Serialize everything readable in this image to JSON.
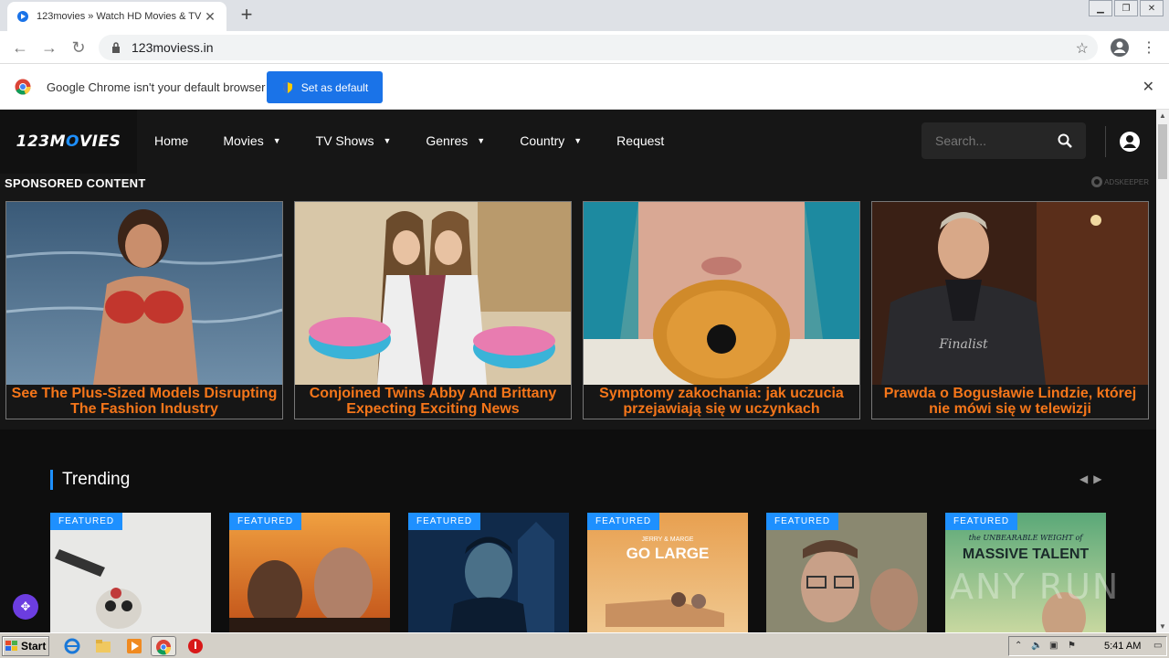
{
  "browser": {
    "tab_title": "123movies » Watch HD Movies & TV",
    "tab_close": "✕",
    "new_tab": "+",
    "url": "123moviess.in",
    "infobar_message": "Google Chrome isn't your default browser",
    "set_default_label": "Set as default",
    "infobar_close": "✕"
  },
  "site": {
    "logo_prefix": "123M",
    "logo_mid": "O",
    "logo_suffix": "VIES",
    "nav": [
      {
        "label": "Home",
        "dropdown": false
      },
      {
        "label": "Movies",
        "dropdown": true
      },
      {
        "label": "TV Shows",
        "dropdown": true
      },
      {
        "label": "Genres",
        "dropdown": true
      },
      {
        "label": "Country",
        "dropdown": true
      },
      {
        "label": "Request",
        "dropdown": false
      }
    ],
    "search_placeholder": "Search..."
  },
  "sponsored": {
    "heading": "SPONSORED CONTENT",
    "provider": "ADSKEEPER",
    "ads": [
      {
        "caption": "See The Plus-Sized Models Disrupting The Fashion Industry"
      },
      {
        "caption": "Conjoined Twins Abby And Brittany Expecting Exciting News"
      },
      {
        "caption": "Symptomy zakochania: jak uczucia przejawiają się w uczynkach"
      },
      {
        "caption": "Prawda o Bogusławie Lindzie, której nie mówi się w telewizji"
      }
    ]
  },
  "trending": {
    "title": "Trending",
    "badge": "FEATURED",
    "cards": [
      {
        "poster_text": ""
      },
      {
        "poster_text": ""
      },
      {
        "poster_text": ""
      },
      {
        "poster_text": "JERRY & MARGE GO LARGE"
      },
      {
        "poster_text": ""
      },
      {
        "poster_text": "the UNBEARABLE WEIGHT of MASSIVE TALENT"
      }
    ]
  },
  "watermark": "ANY RUN",
  "taskbar": {
    "start_label": "Start",
    "clock": "5:41 AM"
  },
  "colors": {
    "accent": "#1e90ff",
    "ad_caption": "#f5761a",
    "chrome_blue": "#1a73e8"
  }
}
